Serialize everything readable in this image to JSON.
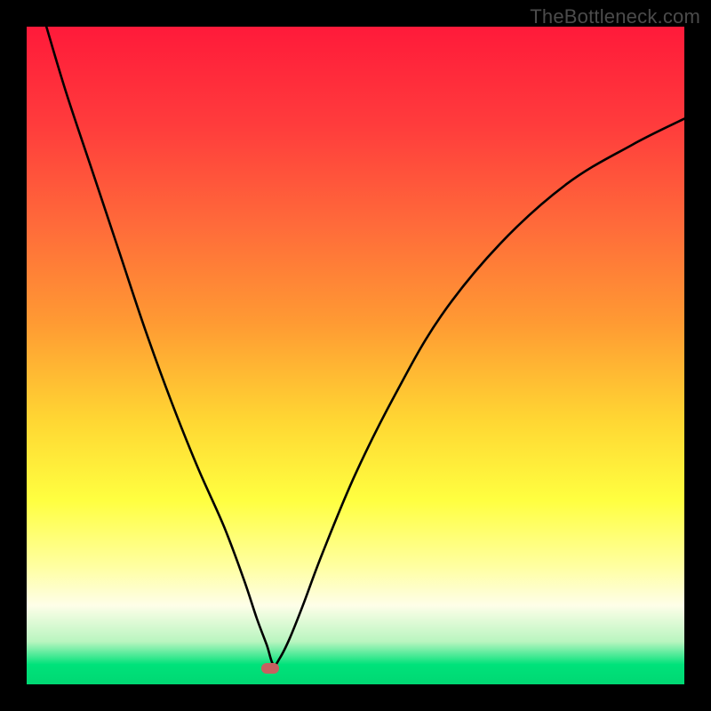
{
  "watermark": "TheBottleneck.com",
  "colors": {
    "background": "#000000",
    "gradient_stops": [
      {
        "offset": 0.0,
        "color": "#ff1a3a"
      },
      {
        "offset": 0.15,
        "color": "#ff3c3c"
      },
      {
        "offset": 0.3,
        "color": "#ff6a3a"
      },
      {
        "offset": 0.45,
        "color": "#ff9a33"
      },
      {
        "offset": 0.6,
        "color": "#ffd733"
      },
      {
        "offset": 0.72,
        "color": "#ffff40"
      },
      {
        "offset": 0.82,
        "color": "#ffffa0"
      },
      {
        "offset": 0.88,
        "color": "#fefee8"
      },
      {
        "offset": 0.935,
        "color": "#b9f5c0"
      },
      {
        "offset": 0.97,
        "color": "#00e27a"
      },
      {
        "offset": 1.0,
        "color": "#00d873"
      }
    ],
    "marker": "#c86060",
    "curve": "#000000"
  },
  "chart_data": {
    "type": "line",
    "title": "",
    "xlabel": "",
    "ylabel": "",
    "xlim": [
      0,
      100
    ],
    "ylim": [
      0,
      100
    ],
    "annotations": [
      {
        "type": "marker",
        "x": 37,
        "y": 2.5,
        "shape": "rounded-rect"
      }
    ],
    "series": [
      {
        "name": "bottleneck-curve",
        "x": [
          3,
          6,
          10,
          14,
          18,
          22,
          26,
          30,
          33,
          35,
          36.5,
          37.5,
          38.5,
          40,
          42,
          45,
          50,
          56,
          63,
          72,
          82,
          92,
          100
        ],
        "y": [
          100,
          90,
          78,
          66,
          54,
          43,
          33,
          24,
          16,
          10,
          6,
          3,
          4,
          7,
          12,
          20,
          32,
          44,
          56,
          67,
          76,
          82,
          86
        ]
      }
    ]
  }
}
